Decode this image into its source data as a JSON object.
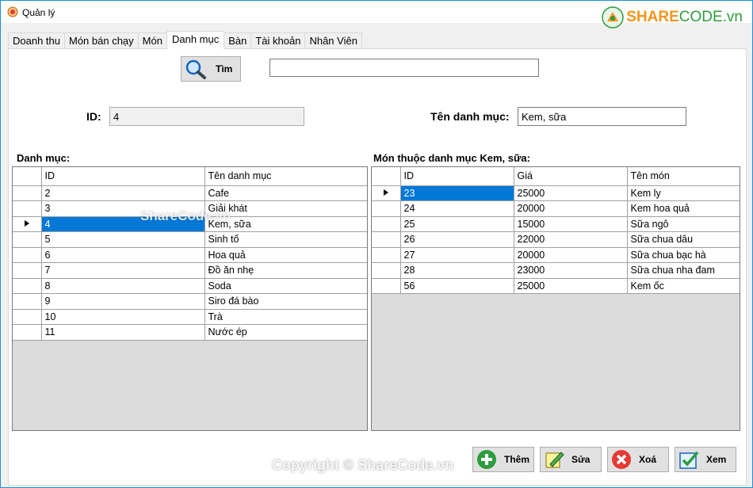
{
  "window": {
    "title": "Quản lý"
  },
  "logo": {
    "part1": "SHARE",
    "part2": "CODE.vn"
  },
  "tabs": [
    {
      "label": "Doanh thu",
      "active": false
    },
    {
      "label": "Món bán chạy",
      "active": false
    },
    {
      "label": "Món",
      "active": false
    },
    {
      "label": "Danh mục",
      "active": true
    },
    {
      "label": "Bàn",
      "active": false
    },
    {
      "label": "Tài khoản",
      "active": false
    },
    {
      "label": "Nhân Viên",
      "active": false
    }
  ],
  "search": {
    "button_label": "Tìm",
    "value": ""
  },
  "form": {
    "id_label": "ID:",
    "id_value": "4",
    "name_label": "Tên danh mục:",
    "name_value": "Kem, sữa"
  },
  "category_grid": {
    "section_label": "Danh mục:",
    "columns": [
      "ID",
      "Tên danh mục"
    ],
    "selected_index": 2,
    "rows": [
      [
        "2",
        "Cafe"
      ],
      [
        "3",
        "Giải khát"
      ],
      [
        "4",
        "Kem, sữa"
      ],
      [
        "5",
        "Sinh tố"
      ],
      [
        "6",
        "Hoa quả"
      ],
      [
        "7",
        "Đồ ăn nhẹ"
      ],
      [
        "8",
        "Soda"
      ],
      [
        "9",
        "Siro đá bào"
      ],
      [
        "10",
        "Trà"
      ],
      [
        "11",
        "Nước ép"
      ]
    ]
  },
  "dish_grid": {
    "section_label": "Món thuộc danh mục Kem, sữa:",
    "columns": [
      "ID",
      "Giá",
      "Tên món"
    ],
    "selected_index": 0,
    "rows": [
      [
        "23",
        "25000",
        "Kem ly"
      ],
      [
        "24",
        "20000",
        "Kem hoa quả"
      ],
      [
        "25",
        "15000",
        "Sữa ngô"
      ],
      [
        "26",
        "22000",
        "Sữa chua dâu"
      ],
      [
        "27",
        "20000",
        "Sữa chua bạc hà"
      ],
      [
        "28",
        "23000",
        "Sữa chua nha đam"
      ],
      [
        "56",
        "25000",
        "Kem ốc"
      ]
    ]
  },
  "actions": {
    "add_label": "Thêm",
    "edit_label": "Sửa",
    "delete_label": "Xoá",
    "view_label": "Xem"
  },
  "watermarks": {
    "center": "ShareCode.vn",
    "bottom": "Copyright © ShareCode.vn"
  },
  "colors": {
    "selection": "#0078d7",
    "window_border": "#1e90d8"
  }
}
